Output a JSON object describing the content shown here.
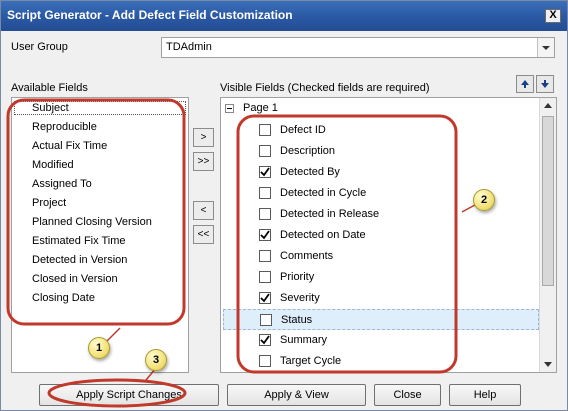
{
  "window": {
    "title": "Script Generator - Add Defect Field Customization",
    "close_symbol": "X"
  },
  "user_group": {
    "label": "User Group",
    "value": "TDAdmin"
  },
  "available": {
    "label": "Available Fields",
    "items": [
      "Subject",
      "Reproducible",
      "Actual Fix Time",
      "Modified",
      "Assigned To",
      "Project",
      "Planned Closing Version",
      "Estimated Fix Time",
      "Detected in Version",
      "Closed in Version",
      "Closing Date"
    ]
  },
  "move_buttons": {
    "add": ">",
    "add_all": ">>",
    "remove": "<",
    "remove_all": "<<"
  },
  "visible": {
    "label": "Visible Fields (Checked fields are required)",
    "page_label": "Page 1",
    "items": [
      {
        "label": "Defect ID",
        "checked": false
      },
      {
        "label": "Description",
        "checked": false
      },
      {
        "label": "Detected By",
        "checked": true
      },
      {
        "label": "Detected in Cycle",
        "checked": false
      },
      {
        "label": "Detected in Release",
        "checked": false
      },
      {
        "label": "Detected on Date",
        "checked": true
      },
      {
        "label": "Comments",
        "checked": false
      },
      {
        "label": "Priority",
        "checked": false
      },
      {
        "label": "Severity",
        "checked": true
      },
      {
        "label": "Status",
        "checked": false
      },
      {
        "label": "Summary",
        "checked": true
      },
      {
        "label": "Target Cycle",
        "checked": false
      }
    ]
  },
  "buttons": {
    "apply_script": "Apply Script Changes",
    "apply_view": "Apply & View",
    "close": "Close",
    "help": "Help"
  },
  "callouts": {
    "one": "1",
    "two": "2",
    "three": "3"
  },
  "colors": {
    "title_bar": "#2a58a3",
    "annotation_red": "#c0392b",
    "badge_yellow": "#f3e37a",
    "row_highlight": "#deeefa"
  },
  "icons": {
    "move_up": "arrow-up-icon",
    "move_down": "arrow-down-icon"
  }
}
